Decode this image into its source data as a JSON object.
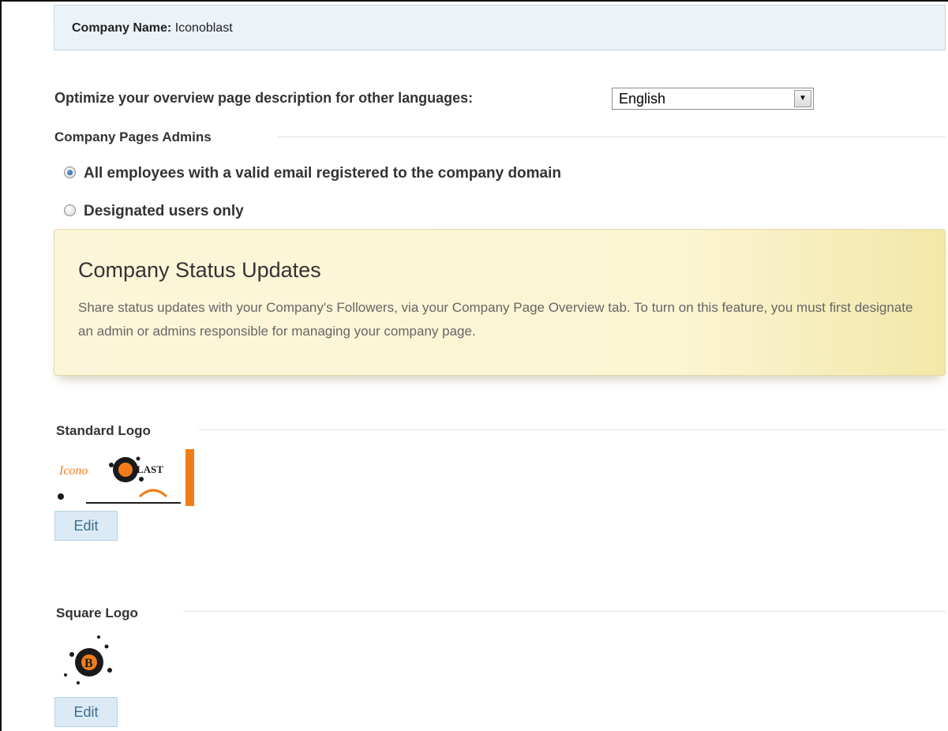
{
  "company": {
    "label": "Company Name:",
    "value": "Iconoblast"
  },
  "language": {
    "label": "Optimize your overview page description for other languages:",
    "selected": "English"
  },
  "admins": {
    "title": "Company Pages Admins",
    "options": [
      {
        "label": "All employees with a valid email registered to the company domain",
        "checked": true
      },
      {
        "label": "Designated users only",
        "checked": false
      }
    ]
  },
  "status_updates": {
    "title": "Company Status Updates",
    "description": "Share status updates with your Company's Followers, via your Company Page Overview tab. To turn on this feature, you must first designate an admin or admins responsible for managing your company page."
  },
  "standard_logo": {
    "title": "Standard Logo",
    "logo_text": "IconoBLAST",
    "edit_label": "Edit"
  },
  "square_logo": {
    "title": "Square Logo",
    "logo_text": "B",
    "edit_label": "Edit"
  },
  "colors": {
    "accent_orange": "#f07d1a",
    "button_bg": "#dbeaf4",
    "button_text": "#3b6e93",
    "status_bg": "#fbf6d9"
  },
  "icons": {
    "dropdown": "chevron-down-icon",
    "radio": "radio-icon"
  }
}
